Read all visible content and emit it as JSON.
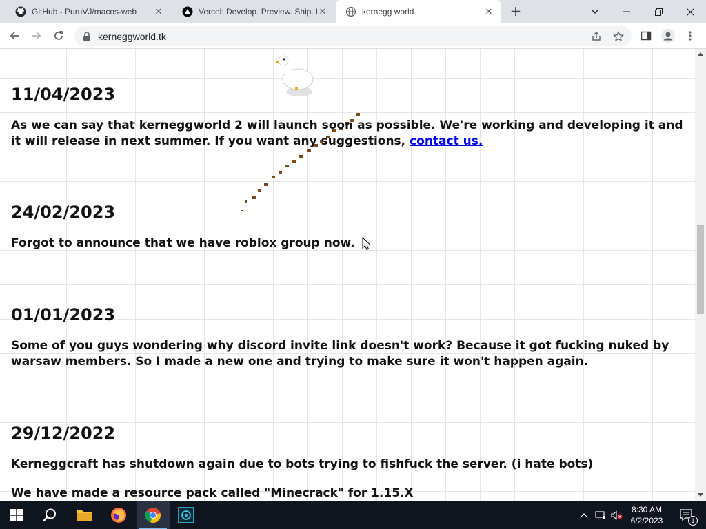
{
  "browser": {
    "tabs": [
      {
        "title": "GitHub - PuruVJ/macos-web",
        "icon": "github-icon",
        "active": false
      },
      {
        "title": "Vercel: Develop. Preview. Ship. Fo",
        "icon": "vercel-icon",
        "active": false
      },
      {
        "title": "kernegg world",
        "icon": "globe-icon",
        "active": true
      }
    ],
    "address": "kerneggworld.tk"
  },
  "page": {
    "posts": [
      {
        "date": "11/04/2023",
        "body": "As we can say that kerneggworld 2 will launch soon as possible. We're working and developing it and it will release in next summer. If you want any suggestions, ",
        "link": "contact us."
      },
      {
        "date": "24/02/2023",
        "body": "Forgot to announce that we have roblox group now."
      },
      {
        "date": "01/01/2023",
        "body": "Some of you guys wondering why discord invite link doesn't work? Because it got fucking nuked by warsaw members. So I made a new one and trying to make sure it won't happen again."
      },
      {
        "date": "29/12/2022",
        "body": "Kerneggcraft has shutdown again due to bots trying to fishfuck the server. (i hate bots)",
        "body2": "We have made a resource pack called \"Minecrack\" for 1.15.X"
      }
    ]
  },
  "taskbar": {
    "time": "8:30 AM",
    "date": "6/2/2023",
    "notification_count": "1"
  },
  "colors": {
    "link": "#0000ee",
    "tabstrip": "#dee1e6",
    "taskbar": "#10151f"
  }
}
